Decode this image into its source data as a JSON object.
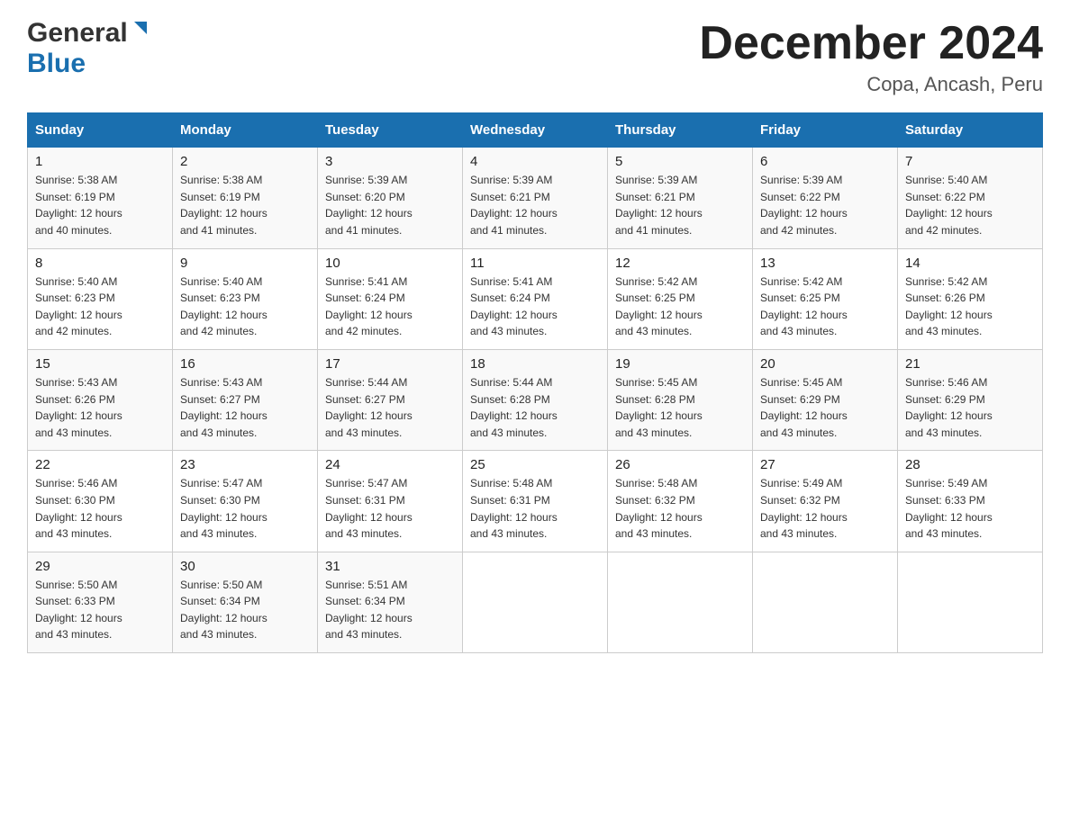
{
  "header": {
    "logo": {
      "general_text": "General",
      "blue_text": "Blue"
    },
    "title": "December 2024",
    "location": "Copa, Ancash, Peru"
  },
  "calendar": {
    "days_of_week": [
      "Sunday",
      "Monday",
      "Tuesday",
      "Wednesday",
      "Thursday",
      "Friday",
      "Saturday"
    ],
    "weeks": [
      [
        {
          "day": "1",
          "sunrise": "5:38 AM",
          "sunset": "6:19 PM",
          "daylight": "12 hours and 40 minutes."
        },
        {
          "day": "2",
          "sunrise": "5:38 AM",
          "sunset": "6:19 PM",
          "daylight": "12 hours and 41 minutes."
        },
        {
          "day": "3",
          "sunrise": "5:39 AM",
          "sunset": "6:20 PM",
          "daylight": "12 hours and 41 minutes."
        },
        {
          "day": "4",
          "sunrise": "5:39 AM",
          "sunset": "6:21 PM",
          "daylight": "12 hours and 41 minutes."
        },
        {
          "day": "5",
          "sunrise": "5:39 AM",
          "sunset": "6:21 PM",
          "daylight": "12 hours and 41 minutes."
        },
        {
          "day": "6",
          "sunrise": "5:39 AM",
          "sunset": "6:22 PM",
          "daylight": "12 hours and 42 minutes."
        },
        {
          "day": "7",
          "sunrise": "5:40 AM",
          "sunset": "6:22 PM",
          "daylight": "12 hours and 42 minutes."
        }
      ],
      [
        {
          "day": "8",
          "sunrise": "5:40 AM",
          "sunset": "6:23 PM",
          "daylight": "12 hours and 42 minutes."
        },
        {
          "day": "9",
          "sunrise": "5:40 AM",
          "sunset": "6:23 PM",
          "daylight": "12 hours and 42 minutes."
        },
        {
          "day": "10",
          "sunrise": "5:41 AM",
          "sunset": "6:24 PM",
          "daylight": "12 hours and 42 minutes."
        },
        {
          "day": "11",
          "sunrise": "5:41 AM",
          "sunset": "6:24 PM",
          "daylight": "12 hours and 43 minutes."
        },
        {
          "day": "12",
          "sunrise": "5:42 AM",
          "sunset": "6:25 PM",
          "daylight": "12 hours and 43 minutes."
        },
        {
          "day": "13",
          "sunrise": "5:42 AM",
          "sunset": "6:25 PM",
          "daylight": "12 hours and 43 minutes."
        },
        {
          "day": "14",
          "sunrise": "5:42 AM",
          "sunset": "6:26 PM",
          "daylight": "12 hours and 43 minutes."
        }
      ],
      [
        {
          "day": "15",
          "sunrise": "5:43 AM",
          "sunset": "6:26 PM",
          "daylight": "12 hours and 43 minutes."
        },
        {
          "day": "16",
          "sunrise": "5:43 AM",
          "sunset": "6:27 PM",
          "daylight": "12 hours and 43 minutes."
        },
        {
          "day": "17",
          "sunrise": "5:44 AM",
          "sunset": "6:27 PM",
          "daylight": "12 hours and 43 minutes."
        },
        {
          "day": "18",
          "sunrise": "5:44 AM",
          "sunset": "6:28 PM",
          "daylight": "12 hours and 43 minutes."
        },
        {
          "day": "19",
          "sunrise": "5:45 AM",
          "sunset": "6:28 PM",
          "daylight": "12 hours and 43 minutes."
        },
        {
          "day": "20",
          "sunrise": "5:45 AM",
          "sunset": "6:29 PM",
          "daylight": "12 hours and 43 minutes."
        },
        {
          "day": "21",
          "sunrise": "5:46 AM",
          "sunset": "6:29 PM",
          "daylight": "12 hours and 43 minutes."
        }
      ],
      [
        {
          "day": "22",
          "sunrise": "5:46 AM",
          "sunset": "6:30 PM",
          "daylight": "12 hours and 43 minutes."
        },
        {
          "day": "23",
          "sunrise": "5:47 AM",
          "sunset": "6:30 PM",
          "daylight": "12 hours and 43 minutes."
        },
        {
          "day": "24",
          "sunrise": "5:47 AM",
          "sunset": "6:31 PM",
          "daylight": "12 hours and 43 minutes."
        },
        {
          "day": "25",
          "sunrise": "5:48 AM",
          "sunset": "6:31 PM",
          "daylight": "12 hours and 43 minutes."
        },
        {
          "day": "26",
          "sunrise": "5:48 AM",
          "sunset": "6:32 PM",
          "daylight": "12 hours and 43 minutes."
        },
        {
          "day": "27",
          "sunrise": "5:49 AM",
          "sunset": "6:32 PM",
          "daylight": "12 hours and 43 minutes."
        },
        {
          "day": "28",
          "sunrise": "5:49 AM",
          "sunset": "6:33 PM",
          "daylight": "12 hours and 43 minutes."
        }
      ],
      [
        {
          "day": "29",
          "sunrise": "5:50 AM",
          "sunset": "6:33 PM",
          "daylight": "12 hours and 43 minutes."
        },
        {
          "day": "30",
          "sunrise": "5:50 AM",
          "sunset": "6:34 PM",
          "daylight": "12 hours and 43 minutes."
        },
        {
          "day": "31",
          "sunrise": "5:51 AM",
          "sunset": "6:34 PM",
          "daylight": "12 hours and 43 minutes."
        },
        null,
        null,
        null,
        null
      ]
    ]
  },
  "labels": {
    "sunrise": "Sunrise:",
    "sunset": "Sunset:",
    "daylight": "Daylight:"
  }
}
